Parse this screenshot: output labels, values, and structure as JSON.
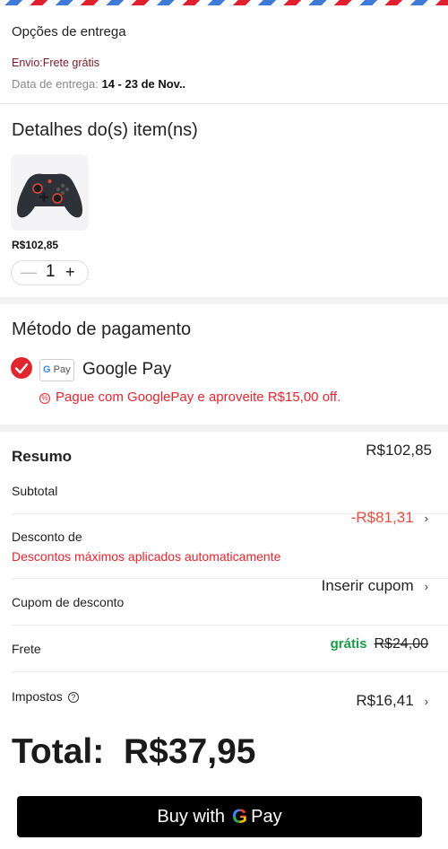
{
  "delivery": {
    "title": "Opções de entrega",
    "shipping": "Envio:Frete grátis",
    "date_label": "Data de entrega:",
    "date_value": "14 - 23 de Nov.."
  },
  "items": {
    "title": "Detalhes do(s) item(ns)",
    "product_icon": "gamepad-controller",
    "price": "R$102,85",
    "minus_symbol": "—",
    "quantity": "1",
    "plus_symbol": "+"
  },
  "payment": {
    "title": "Método de pagamento",
    "selected": true,
    "badge_g": "G",
    "badge_pay": "Pay",
    "method_name": "Google Pay",
    "promo_text": "Pague com GooglePay e aproveite R$15,00 off.",
    "accent_color": "#e0262e"
  },
  "summary": {
    "title": "Resumo",
    "items_total": "R$102,85",
    "subtotal_label": "Subtotal",
    "discount_label": "Desconto de",
    "discount_value": "-R$81,31",
    "discount_note": "Descontos máximos aplicados automaticamente",
    "coupon_label": "Cupom de desconto",
    "coupon_action": "Inserir cupom",
    "shipping_label": "Frete",
    "shipping_free": "grátis",
    "shipping_original": "R$24,00",
    "taxes_label": "Impostos",
    "taxes_value": "R$16,41"
  },
  "total": {
    "label": "Total:",
    "value": "R$37,95"
  },
  "checkout": {
    "prefix": "Buy with",
    "g": "G",
    "suffix": "Pay"
  }
}
